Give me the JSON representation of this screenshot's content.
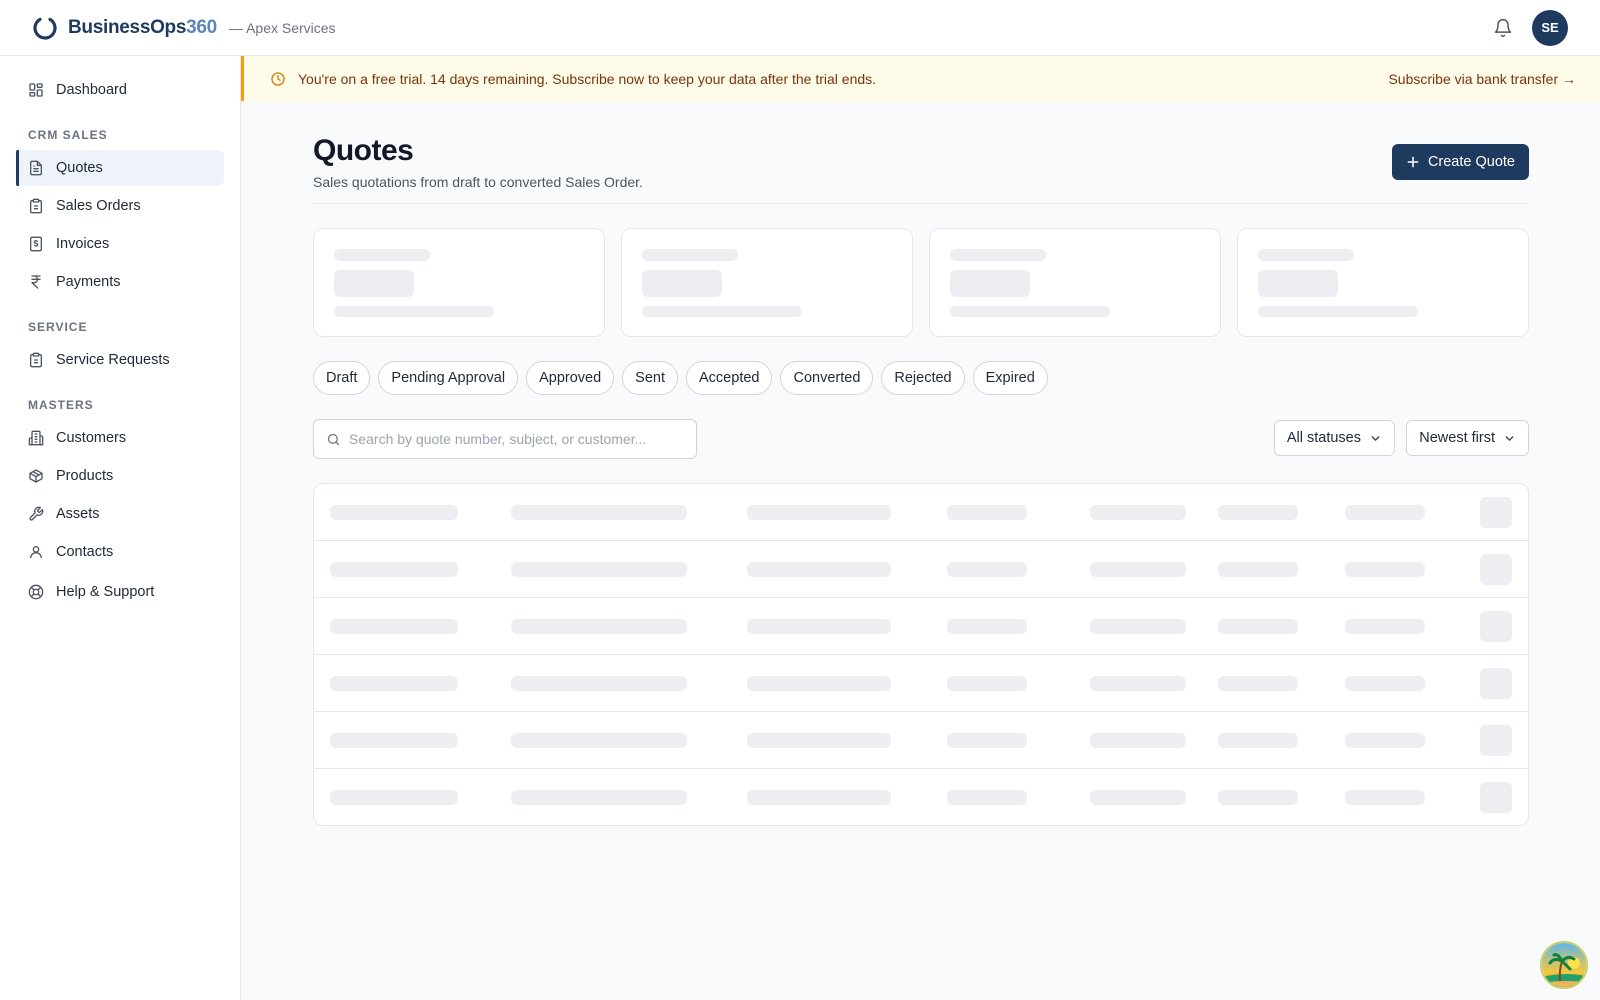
{
  "header": {
    "brand_name": "BusinessOps",
    "brand_num": "360",
    "org": "— Apex Services",
    "avatar_initials": "SE"
  },
  "sidebar": {
    "top_items": [
      {
        "label": "Dashboard",
        "icon": "dashboard-icon"
      }
    ],
    "sections": [
      {
        "title": "CRM SALES",
        "items": [
          {
            "label": "Quotes",
            "icon": "document-icon",
            "active": true
          },
          {
            "label": "Sales Orders",
            "icon": "clipboard-icon"
          },
          {
            "label": "Invoices",
            "icon": "invoice-icon"
          },
          {
            "label": "Payments",
            "icon": "rupee-icon"
          }
        ]
      },
      {
        "title": "SERVICE",
        "items": [
          {
            "label": "Service Requests",
            "icon": "clipboard-icon"
          }
        ]
      },
      {
        "title": "MASTERS",
        "items": [
          {
            "label": "Customers",
            "icon": "building-icon"
          },
          {
            "label": "Products",
            "icon": "box-icon"
          },
          {
            "label": "Assets",
            "icon": "wrench-icon"
          },
          {
            "label": "Contacts",
            "icon": "user-icon"
          },
          {
            "label": "Help & Support",
            "icon": "lifebuoy-icon"
          }
        ]
      }
    ]
  },
  "banner": {
    "message": "You're on a free trial. 14 days remaining. Subscribe now to keep your data after the trial ends.",
    "link": "Subscribe via bank transfer →"
  },
  "page": {
    "title": "Quotes",
    "subtitle": "Sales quotations from draft to converted Sales Order.",
    "create_label": "Create Quote"
  },
  "status_chips": [
    "Draft",
    "Pending Approval",
    "Approved",
    "Sent",
    "Accepted",
    "Converted",
    "Rejected",
    "Expired"
  ],
  "filters": {
    "search_placeholder": "Search by quote number, subject, or customer...",
    "status_select": "All statuses",
    "sort_select": "Newest first"
  },
  "colors": {
    "brand": "#1e3a5f",
    "accent": "#5b86b5",
    "banner_bg": "#fefbe8",
    "banner_border": "#f59e0b"
  }
}
